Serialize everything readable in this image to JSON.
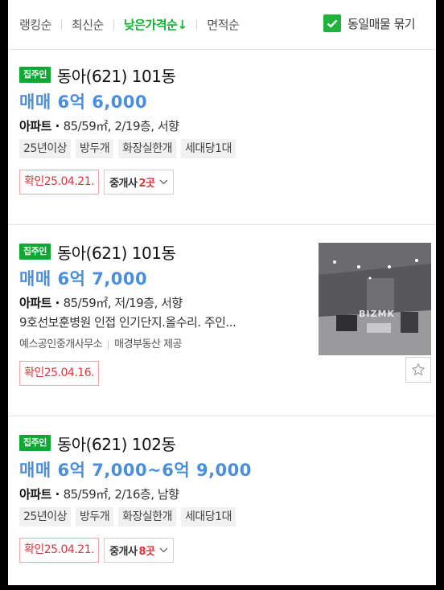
{
  "sort": {
    "options": [
      "랭킹순",
      "최신순",
      "낮은가격순↓",
      "면적순"
    ],
    "active_index": 2,
    "group_same_label": "동일매물 묶기",
    "group_same_checked": true
  },
  "colors": {
    "accent_green": "#13b234",
    "price_blue": "#4a8ee0",
    "confirm_red": "#e1323a"
  },
  "listings": [
    {
      "badge": "집주인",
      "name": "동아(621) 101동",
      "price": "매매 6억 6,000",
      "type": "아파트",
      "spec": "85/59㎡, 2/19층, 서향",
      "tags": [
        "25년이상",
        "방두개",
        "화장실한개",
        "세대당1대"
      ],
      "confirm": "확인25.04.21.",
      "agent_label": "중개사",
      "agent_count": "2곳"
    },
    {
      "badge": "집주인",
      "name": "동아(621) 101동",
      "price": "매매 6억 7,000",
      "type": "아파트",
      "spec": "85/59㎡, 저/19층, 서향",
      "description": "9호선보훈병원 인접 인기단지.올수리. 주인...",
      "source": "예스공인중개사무소",
      "provider": "매경부동산 제공",
      "confirm": "확인25.04.16.",
      "thumb_watermark": "BIZMK",
      "thumb_icon": "apartment-room-photo",
      "fav_icon": "star-outline-icon"
    },
    {
      "badge": "집주인",
      "name": "동아(621) 102동",
      "price": "매매 6억 7,000~6억 9,000",
      "type": "아파트",
      "spec": "85/59㎡, 2/16층, 남향",
      "tags": [
        "25년이상",
        "방두개",
        "화장실한개",
        "세대당1대"
      ],
      "confirm": "확인25.04.21.",
      "agent_label": "중개사",
      "agent_count": "8곳"
    }
  ]
}
